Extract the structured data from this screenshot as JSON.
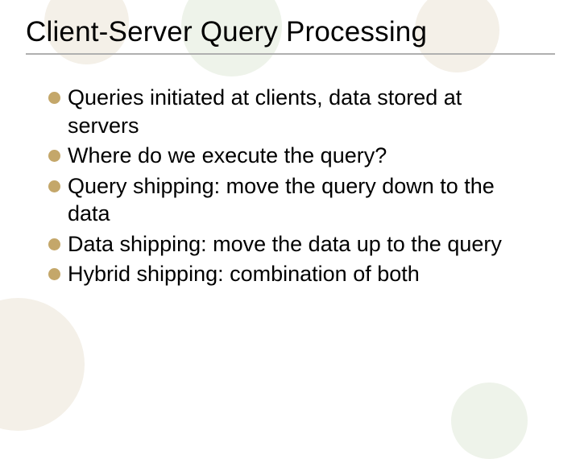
{
  "slide": {
    "title": "Client-Server Query Processing",
    "bullets": [
      {
        "text": "Queries initiated at clients, data stored at servers"
      },
      {
        "text": "Where do we execute the query?"
      },
      {
        "text": "Query shipping: move the query down to the data"
      },
      {
        "text": "Data shipping: move the data up to the query"
      },
      {
        "text": "Hybrid shipping: combination of both"
      }
    ]
  }
}
